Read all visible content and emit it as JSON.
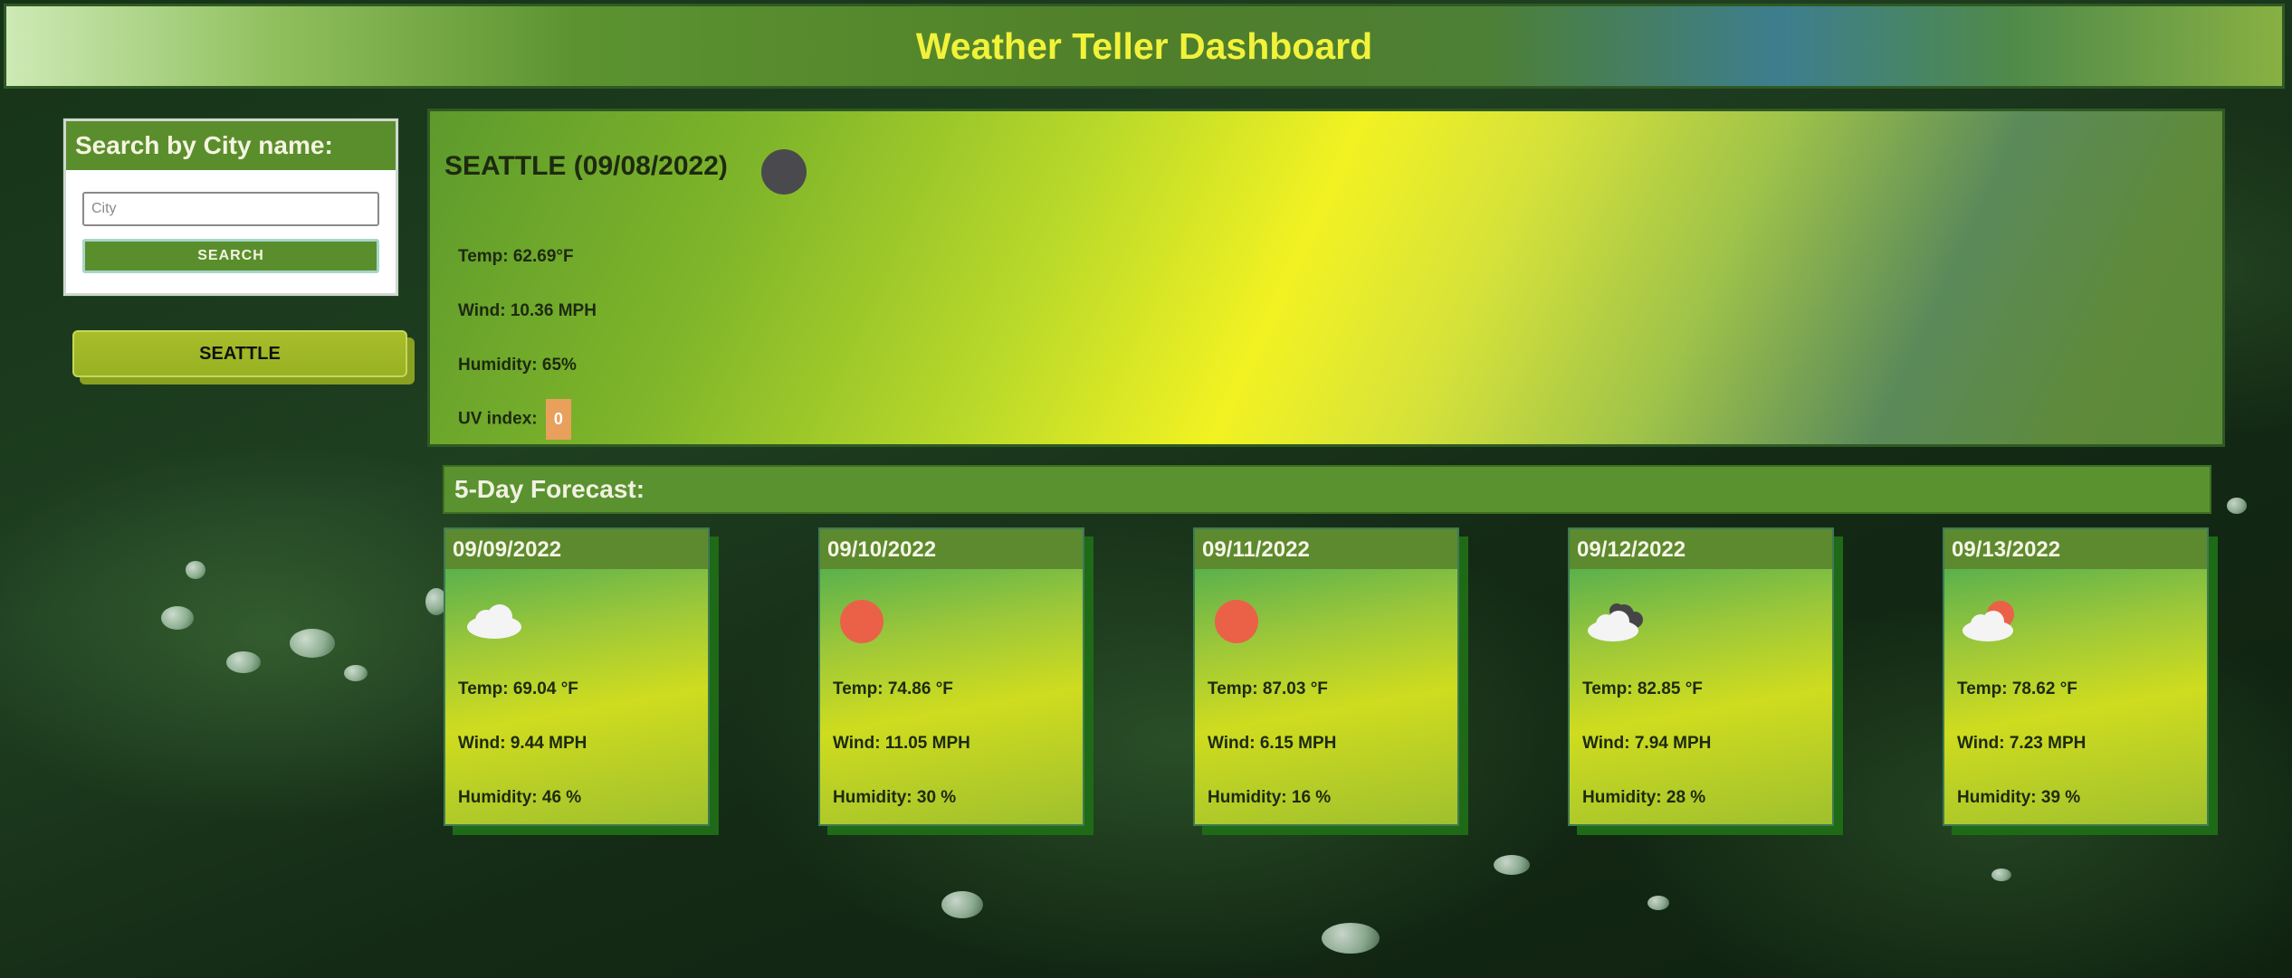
{
  "header": {
    "title": "Weather Teller Dashboard"
  },
  "search": {
    "heading": "Search by City name:",
    "input_placeholder": "City",
    "input_value": "",
    "button_label": "SEARCH"
  },
  "history": {
    "cities": [
      "SEATTLE"
    ]
  },
  "current": {
    "title": "SEATTLE (09/08/2022)",
    "icon": "moon-icon",
    "temp": "Temp: 62.69°F",
    "wind": "Wind: 10.36 MPH",
    "humidity": "Humidity: 65%",
    "uv_label": "UV index:",
    "uv_value": "0",
    "uv_color": "#e8a05c"
  },
  "forecast": {
    "heading": "5-Day Forecast:",
    "days": [
      {
        "date": "09/09/2022",
        "icon": "cloud-icon",
        "temp": "Temp: 69.04 °F",
        "wind": "Wind: 9.44 MPH",
        "humidity": "Humidity: 46 %"
      },
      {
        "date": "09/10/2022",
        "icon": "sun-icon",
        "temp": "Temp: 74.86 °F",
        "wind": "Wind: 11.05 MPH",
        "humidity": "Humidity: 30 %"
      },
      {
        "date": "09/11/2022",
        "icon": "sun-icon",
        "temp": "Temp: 87.03 °F",
        "wind": "Wind: 6.15 MPH",
        "humidity": "Humidity: 16 %"
      },
      {
        "date": "09/12/2022",
        "icon": "broken-clouds-icon",
        "temp": "Temp: 82.85 °F",
        "wind": "Wind: 7.94 MPH",
        "humidity": "Humidity: 28 %"
      },
      {
        "date": "09/13/2022",
        "icon": "partly-cloudy-icon",
        "temp": "Temp: 78.62 °F",
        "wind": "Wind: 7.23 MPH",
        "humidity": "Humidity: 39 %"
      }
    ]
  }
}
